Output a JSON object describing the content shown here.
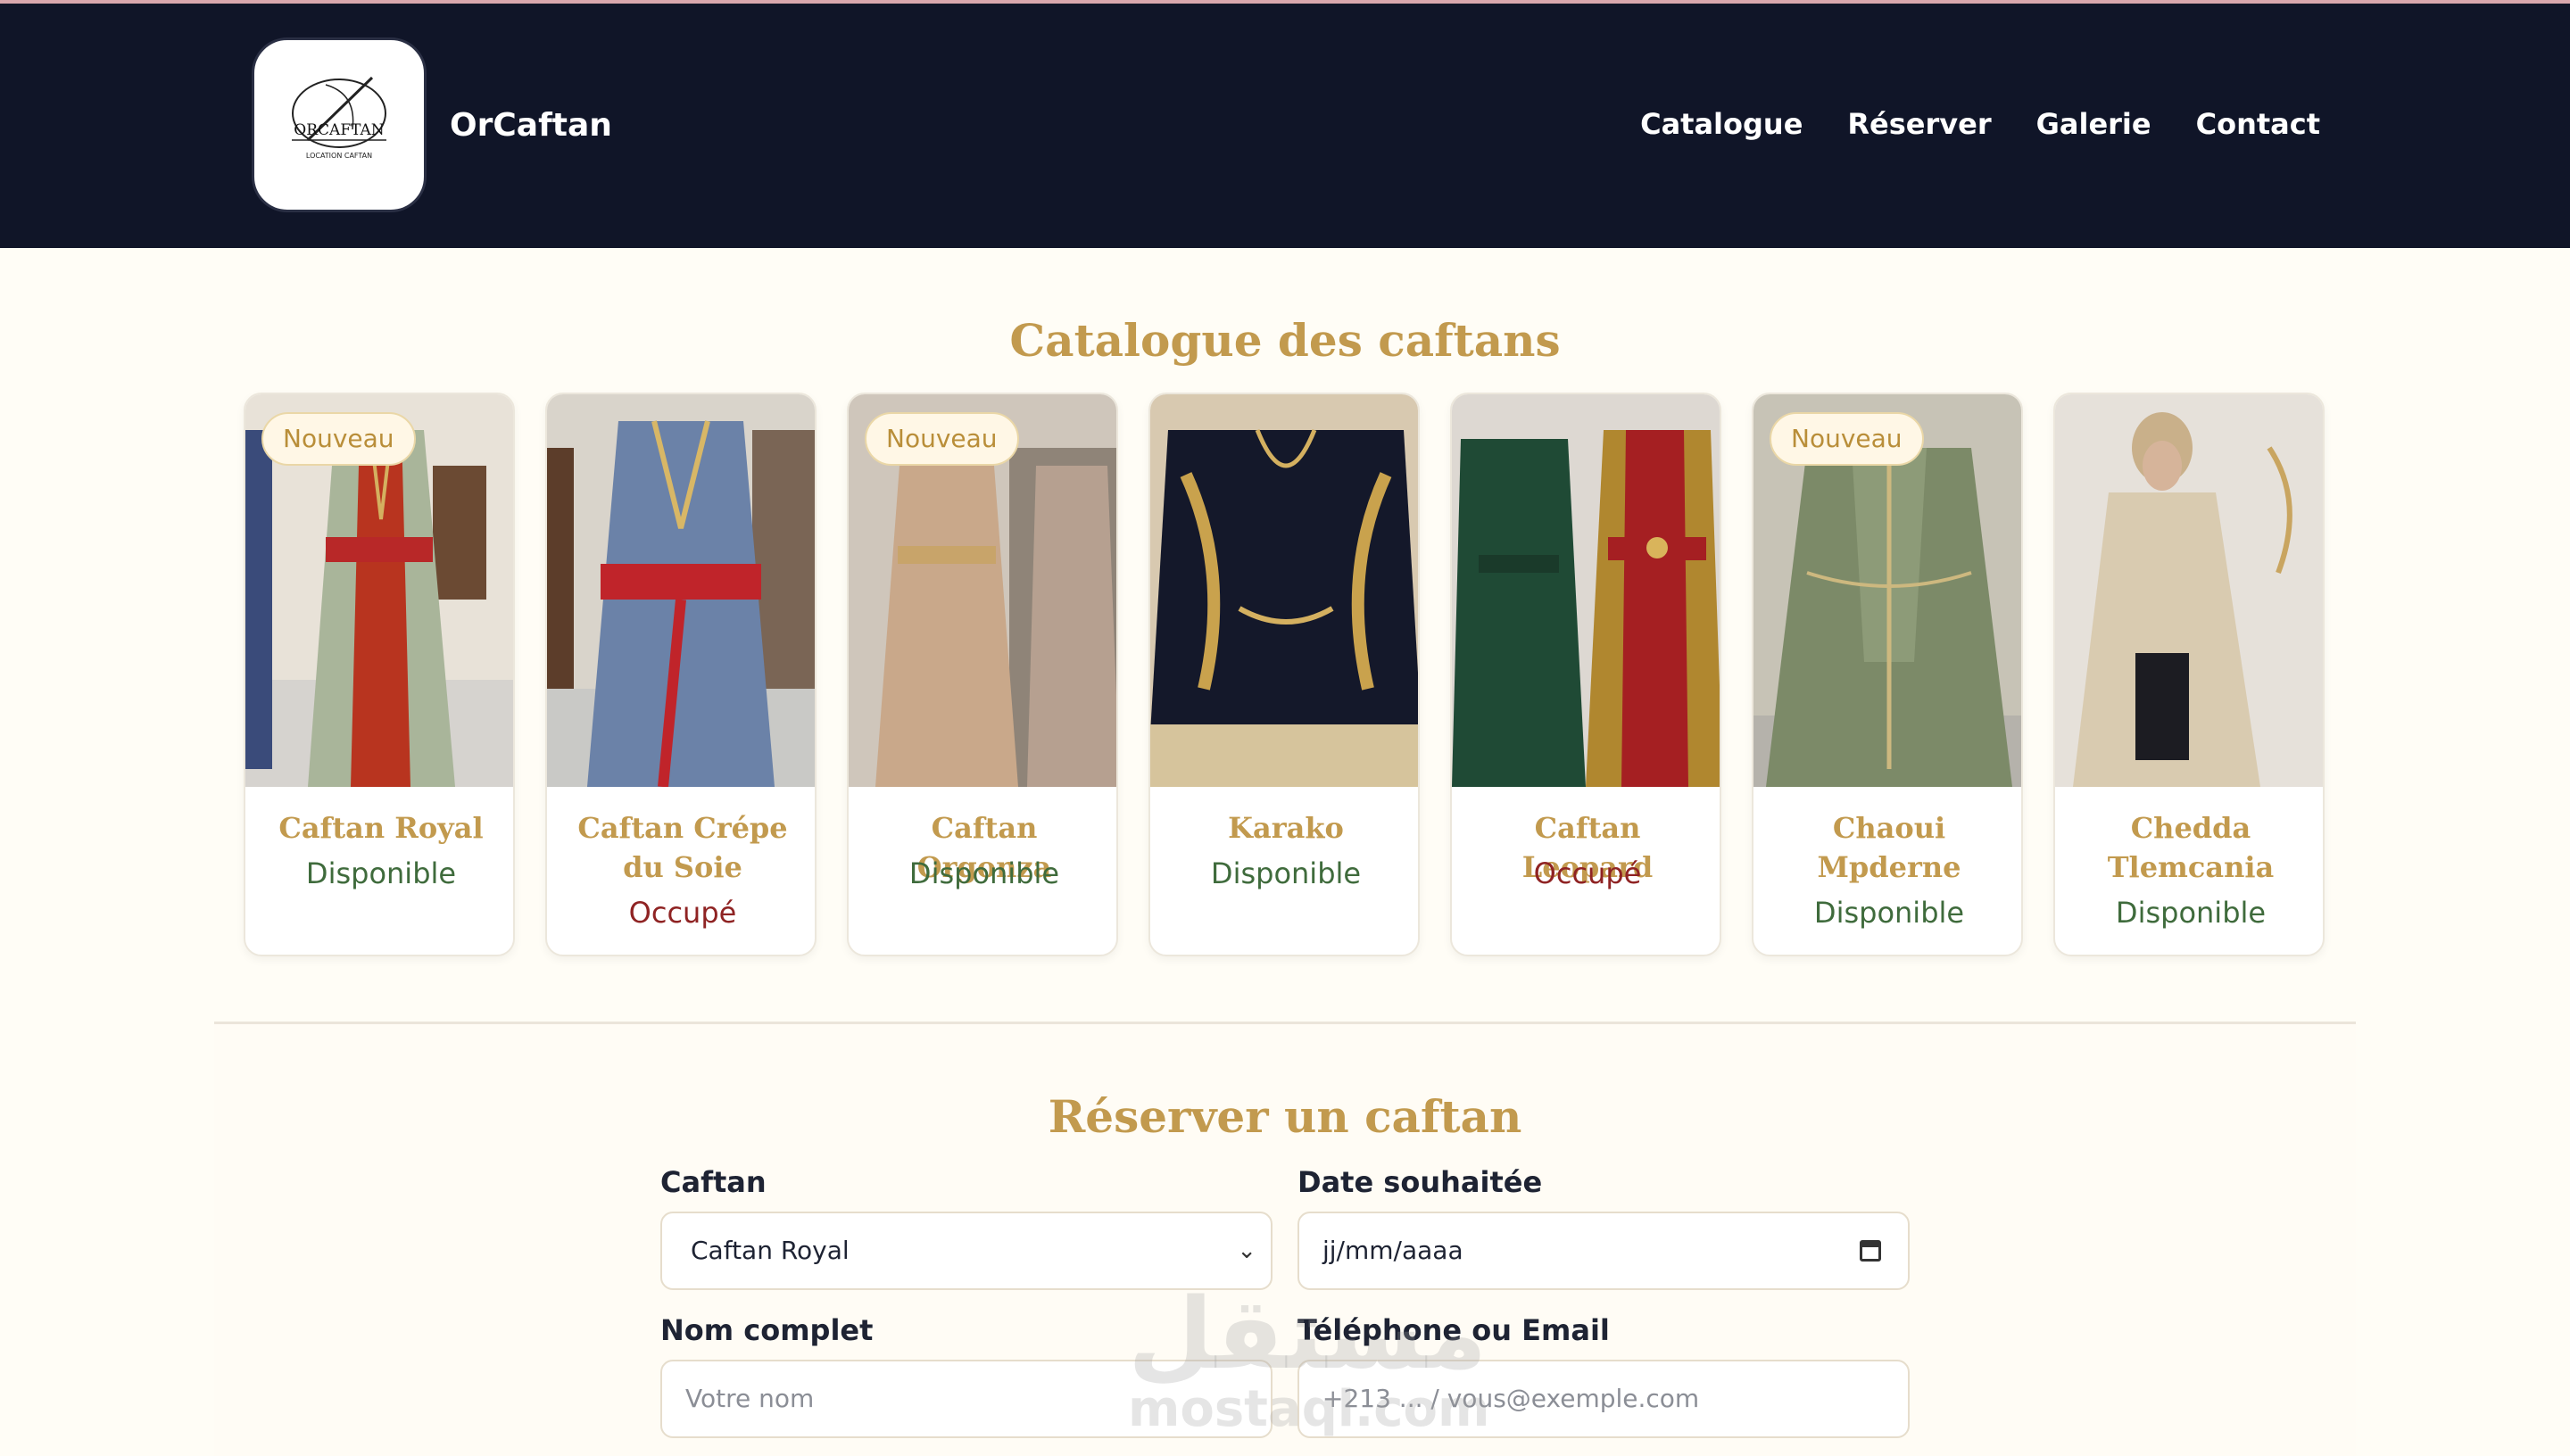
{
  "header": {
    "logo_text": "ORCAFTAN",
    "logo_subtext": "LOCATION CAFTAN",
    "brand": "OrCaftan",
    "nav": [
      "Catalogue",
      "Réserver",
      "Galerie",
      "Contact"
    ]
  },
  "catalogue": {
    "title": "Catalogue des caftans",
    "items": [
      {
        "name": "Caftan Royal",
        "status": "Disponible",
        "badge": "Nouveau"
      },
      {
        "name": "Caftan Crépe du Soie",
        "status": "Occupé",
        "badge": ""
      },
      {
        "name": "Caftan Orgonza",
        "status": "Disponible",
        "badge": "Nouveau"
      },
      {
        "name": "Karako",
        "status": "Disponible",
        "badge": ""
      },
      {
        "name": "Caftan Leopard",
        "status": "Occupé",
        "badge": ""
      },
      {
        "name": "Chaoui Mpderne",
        "status": "Disponible",
        "badge": "Nouveau"
      },
      {
        "name": "Chedda Tlemcania",
        "status": "Disponible",
        "badge": ""
      }
    ]
  },
  "reservation": {
    "title": "Réserver un caftan",
    "caftan_label": "Caftan",
    "caftan_value": "Caftan Royal",
    "date_label": "Date souhaitée",
    "date_placeholder": "jj/mm/aaaa",
    "name_label": "Nom complet",
    "name_placeholder": "Votre nom",
    "contact_label": "Téléphone ou Email",
    "contact_placeholder": "+213 ... / vous@exemple.com"
  },
  "watermark": {
    "arabic": "مستقل",
    "latin": "mostaql.com"
  },
  "colors": {
    "header_bg": "#101528",
    "gold": "#c29a4e",
    "available": "#3f6b3c",
    "busy": "#8f2323",
    "page_bg": "#fffdf6"
  }
}
